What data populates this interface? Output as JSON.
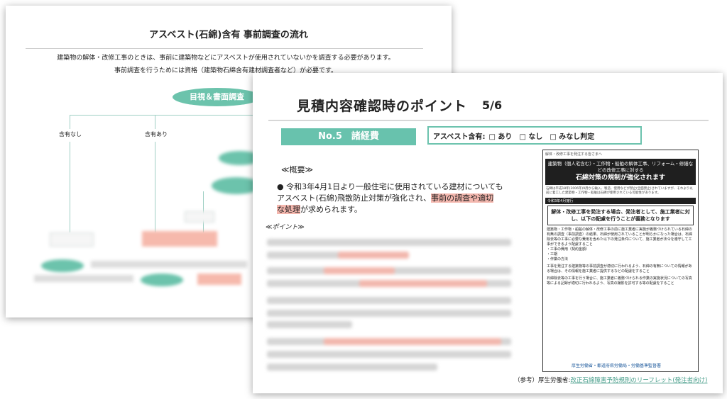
{
  "back_sheet": {
    "title": "アスベスト(石綿)含有 事前調査の流れ",
    "intro_line1": "建築物の解体・改修工事のときは、事前に建築物などにアスベストが使用されていないかを調査する必要があります。",
    "intro_line2": "事前調査を行うためには資格（建築物石綿含有建材調査者など）が必要です。",
    "flow_oval": "目視＆書面調査",
    "branch_none": "含有なし",
    "branch_yes": "含有あり"
  },
  "front_sheet": {
    "title": "見積内容確認時のポイント",
    "page": "5/6",
    "section_label": "No.5　諸経費",
    "asbestos_label": "アスベスト含有:",
    "options": [
      "□ あり",
      "□ なし",
      "□ みなし判定"
    ],
    "overview_heading": "≪概要≫",
    "bullet_plain1": "令和3年4月1日より一般住宅に使用されている建材についても",
    "bullet_plain2": "アスベスト(石綿)飛散防止対策が強化され、",
    "bullet_highlight1": "事前の調査や適切",
    "bullet_highlight2": "な処理",
    "bullet_plain3": "が求められます。",
    "points_heading": "≪ポイント≫",
    "reference_prefix": "（参考）厚生労働省:",
    "reference_link": "改正石綿障害予防規則のリーフレット(発注者向け)"
  },
  "leaflet": {
    "top_text": "解体・改修工事を発注する皆さまへ",
    "head1": "建築物（個人宅含む）・工作物・船舶の解体工事、リフォーム・修繕などの改修工事に対する",
    "head2": "石綿対策の規制が強化されます",
    "small": "石綿は平成18年(2006年)9月から輸入、製造、使用などが禁止(全面禁止)されていますが、それより以前に着工した建築物・工作物・船舶は石綿が使用されている可能性があります。",
    "band": "令和3年4月施行",
    "box_text": "解体・改修工事を発注する場合、発注者として、施工業者に対し、以下の配慮を行うことが義務となります",
    "bullet1": "建築物・工作物・船舶の解体・改修工事の前に施工業者に実施が義務づけられている石綿の有無の調査（事前調査）の結果、石綿が使用されていることが明らかになった場合は、石綿除去等の工事に必要な費用を含めた以下の発注条件について、施工業者が法令を遵守して工事ができるよう配慮すること",
    "sub1": "・工事の費用（契約金額）",
    "sub2": "・工期",
    "sub3": "・作業の方法",
    "bullet2": "工事を発注する建築物等の事前調査が適切に行われるよう、石綿の有無についての情報がある場合は、その情報を施工業者に提供するなどの配慮をすること",
    "bullet3": "石綿除去等の工事を行う場合に、施工業者に義務づけられる作業の実施状況についての写真等による記録が適切に行われるよう、写真の撮影を許可する等の配慮をすること",
    "footer": "厚生労働省・都道府県労働局・労働基準監督署"
  }
}
